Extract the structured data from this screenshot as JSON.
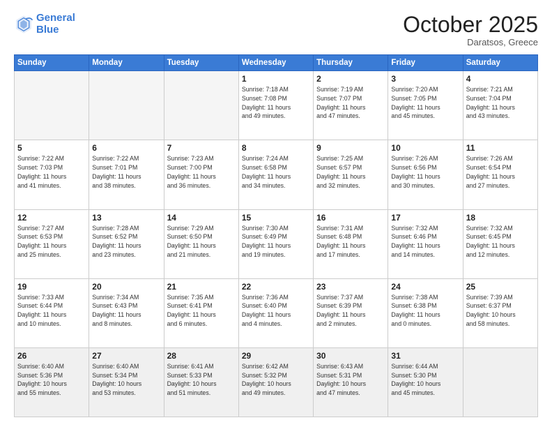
{
  "header": {
    "logo_line1": "General",
    "logo_line2": "Blue",
    "month": "October 2025",
    "location": "Daratsos, Greece"
  },
  "weekdays": [
    "Sunday",
    "Monday",
    "Tuesday",
    "Wednesday",
    "Thursday",
    "Friday",
    "Saturday"
  ],
  "weeks": [
    [
      {
        "day": "",
        "info": ""
      },
      {
        "day": "",
        "info": ""
      },
      {
        "day": "",
        "info": ""
      },
      {
        "day": "1",
        "info": "Sunrise: 7:18 AM\nSunset: 7:08 PM\nDaylight: 11 hours\nand 49 minutes."
      },
      {
        "day": "2",
        "info": "Sunrise: 7:19 AM\nSunset: 7:07 PM\nDaylight: 11 hours\nand 47 minutes."
      },
      {
        "day": "3",
        "info": "Sunrise: 7:20 AM\nSunset: 7:05 PM\nDaylight: 11 hours\nand 45 minutes."
      },
      {
        "day": "4",
        "info": "Sunrise: 7:21 AM\nSunset: 7:04 PM\nDaylight: 11 hours\nand 43 minutes."
      }
    ],
    [
      {
        "day": "5",
        "info": "Sunrise: 7:22 AM\nSunset: 7:03 PM\nDaylight: 11 hours\nand 41 minutes."
      },
      {
        "day": "6",
        "info": "Sunrise: 7:22 AM\nSunset: 7:01 PM\nDaylight: 11 hours\nand 38 minutes."
      },
      {
        "day": "7",
        "info": "Sunrise: 7:23 AM\nSunset: 7:00 PM\nDaylight: 11 hours\nand 36 minutes."
      },
      {
        "day": "8",
        "info": "Sunrise: 7:24 AM\nSunset: 6:58 PM\nDaylight: 11 hours\nand 34 minutes."
      },
      {
        "day": "9",
        "info": "Sunrise: 7:25 AM\nSunset: 6:57 PM\nDaylight: 11 hours\nand 32 minutes."
      },
      {
        "day": "10",
        "info": "Sunrise: 7:26 AM\nSunset: 6:56 PM\nDaylight: 11 hours\nand 30 minutes."
      },
      {
        "day": "11",
        "info": "Sunrise: 7:26 AM\nSunset: 6:54 PM\nDaylight: 11 hours\nand 27 minutes."
      }
    ],
    [
      {
        "day": "12",
        "info": "Sunrise: 7:27 AM\nSunset: 6:53 PM\nDaylight: 11 hours\nand 25 minutes."
      },
      {
        "day": "13",
        "info": "Sunrise: 7:28 AM\nSunset: 6:52 PM\nDaylight: 11 hours\nand 23 minutes."
      },
      {
        "day": "14",
        "info": "Sunrise: 7:29 AM\nSunset: 6:50 PM\nDaylight: 11 hours\nand 21 minutes."
      },
      {
        "day": "15",
        "info": "Sunrise: 7:30 AM\nSunset: 6:49 PM\nDaylight: 11 hours\nand 19 minutes."
      },
      {
        "day": "16",
        "info": "Sunrise: 7:31 AM\nSunset: 6:48 PM\nDaylight: 11 hours\nand 17 minutes."
      },
      {
        "day": "17",
        "info": "Sunrise: 7:32 AM\nSunset: 6:46 PM\nDaylight: 11 hours\nand 14 minutes."
      },
      {
        "day": "18",
        "info": "Sunrise: 7:32 AM\nSunset: 6:45 PM\nDaylight: 11 hours\nand 12 minutes."
      }
    ],
    [
      {
        "day": "19",
        "info": "Sunrise: 7:33 AM\nSunset: 6:44 PM\nDaylight: 11 hours\nand 10 minutes."
      },
      {
        "day": "20",
        "info": "Sunrise: 7:34 AM\nSunset: 6:43 PM\nDaylight: 11 hours\nand 8 minutes."
      },
      {
        "day": "21",
        "info": "Sunrise: 7:35 AM\nSunset: 6:41 PM\nDaylight: 11 hours\nand 6 minutes."
      },
      {
        "day": "22",
        "info": "Sunrise: 7:36 AM\nSunset: 6:40 PM\nDaylight: 11 hours\nand 4 minutes."
      },
      {
        "day": "23",
        "info": "Sunrise: 7:37 AM\nSunset: 6:39 PM\nDaylight: 11 hours\nand 2 minutes."
      },
      {
        "day": "24",
        "info": "Sunrise: 7:38 AM\nSunset: 6:38 PM\nDaylight: 11 hours\nand 0 minutes."
      },
      {
        "day": "25",
        "info": "Sunrise: 7:39 AM\nSunset: 6:37 PM\nDaylight: 10 hours\nand 58 minutes."
      }
    ],
    [
      {
        "day": "26",
        "info": "Sunrise: 6:40 AM\nSunset: 5:36 PM\nDaylight: 10 hours\nand 55 minutes."
      },
      {
        "day": "27",
        "info": "Sunrise: 6:40 AM\nSunset: 5:34 PM\nDaylight: 10 hours\nand 53 minutes."
      },
      {
        "day": "28",
        "info": "Sunrise: 6:41 AM\nSunset: 5:33 PM\nDaylight: 10 hours\nand 51 minutes."
      },
      {
        "day": "29",
        "info": "Sunrise: 6:42 AM\nSunset: 5:32 PM\nDaylight: 10 hours\nand 49 minutes."
      },
      {
        "day": "30",
        "info": "Sunrise: 6:43 AM\nSunset: 5:31 PM\nDaylight: 10 hours\nand 47 minutes."
      },
      {
        "day": "31",
        "info": "Sunrise: 6:44 AM\nSunset: 5:30 PM\nDaylight: 10 hours\nand 45 minutes."
      },
      {
        "day": "",
        "info": ""
      }
    ]
  ]
}
